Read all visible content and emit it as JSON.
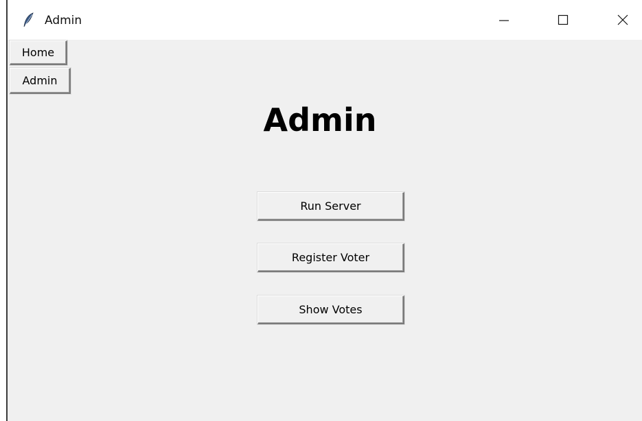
{
  "window": {
    "title": "Admin",
    "icon": "tk-feather-icon",
    "controls": [
      "minimize",
      "maximize",
      "close"
    ]
  },
  "nav": {
    "home_label": "Home",
    "admin_label": "Admin"
  },
  "main": {
    "heading": "Admin",
    "buttons": [
      {
        "label": "Run Server"
      },
      {
        "label": "Register Voter"
      },
      {
        "label": "Show Votes"
      }
    ]
  },
  "colors": {
    "client_bg": "#f0f0f0",
    "titlebar_bg": "#ffffff",
    "text": "#000000"
  }
}
